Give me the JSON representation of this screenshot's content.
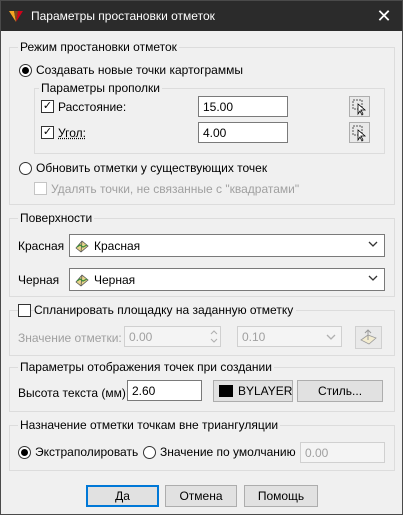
{
  "window": {
    "title": "Параметры простановки отметок",
    "close_glyph": "✕"
  },
  "mode": {
    "legend": "Режим простановки отметок",
    "create_label": "Создавать новые точки картограммы",
    "params_legend": "Параметры прополки",
    "distance_label": "Расстояние:",
    "distance_value": "15.00",
    "angle_label": "Угол:",
    "angle_value": "4.00",
    "update_label": "Обновить отметки у существующих точек",
    "delete_label": "Удалять точки, не связанные с \"квадратами\""
  },
  "surfaces": {
    "legend": "Поверхности",
    "red_label": "Красная",
    "red_value": "Красная",
    "black_label": "Черная",
    "black_value": "Черная"
  },
  "plan": {
    "checkbox_label": "Спланировать площадку на заданную отметку",
    "value_label": "Значение отметки:",
    "value": "0.00",
    "step_value": "0.10"
  },
  "display": {
    "legend": "Параметры отображения точек при создании",
    "height_label": "Высота текста (мм):",
    "height_value": "2.60",
    "color_value": "BYLAYER",
    "style_button": "Стиль..."
  },
  "outside": {
    "legend": "Назначение отметки точкам вне триангуляции",
    "extrapolate_label": "Экстраполировать",
    "default_label": "Значение по умолчанию",
    "default_value": "0.00"
  },
  "footer": {
    "ok": "Да",
    "cancel": "Отмена",
    "help": "Помощь"
  },
  "colors": {
    "titlebar": "#2b2b2b",
    "accent": "#0078d7",
    "swatch": "#000000"
  }
}
